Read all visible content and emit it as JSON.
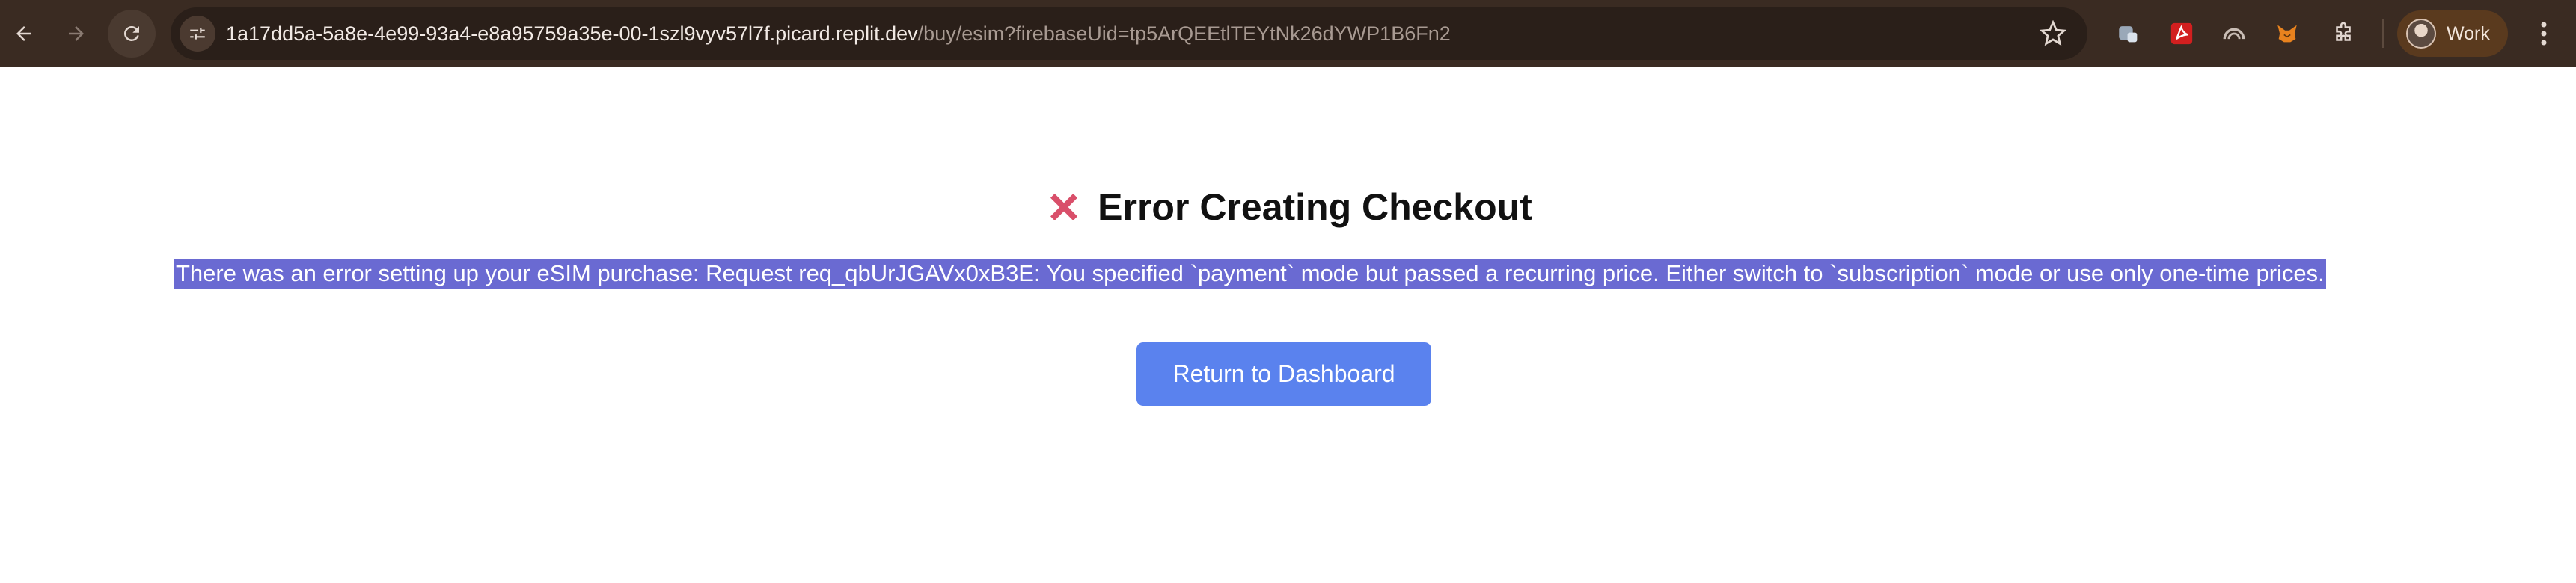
{
  "browser": {
    "address_bar": {
      "host": "1a17dd5a-5a8e-4e99-93a4-e8a95759a35e-00-1szl9vyv57l7f.picard.replit.dev",
      "path": "/buy/esim?firebaseUid=tp5ArQEEtlTEYtNk26dYWP1B6Fn2"
    },
    "nav_icons": [
      "back-arrow-icon",
      "forward-arrow-icon",
      "reload-icon"
    ],
    "extensions": [
      "extension-puzzle-badge-icon",
      "acrobat-icon",
      "speedometer-icon",
      "metamask-fox-icon",
      "extensions-puzzle-icon"
    ],
    "profile": {
      "label": "Work"
    },
    "colors": {
      "toolbar": "#3a2b22",
      "omnibox": "#2a1f19",
      "profile_chip": "#5a3a1e"
    }
  },
  "page": {
    "title": "Error Creating Checkout",
    "title_icon": "red-x-cross-icon",
    "message": "There was an error setting up your eSIM purchase: Request req_qbUrJGAVx0xB3E: You specified `payment` mode but passed a recurring price. Either switch to `subscription` mode or use only one-time prices.",
    "message_selected": true,
    "button_label": "Return to Dashboard",
    "colors": {
      "button": "#5a82ee",
      "selection": "#6a6ad2",
      "error_icon": "#d94f6a"
    }
  }
}
